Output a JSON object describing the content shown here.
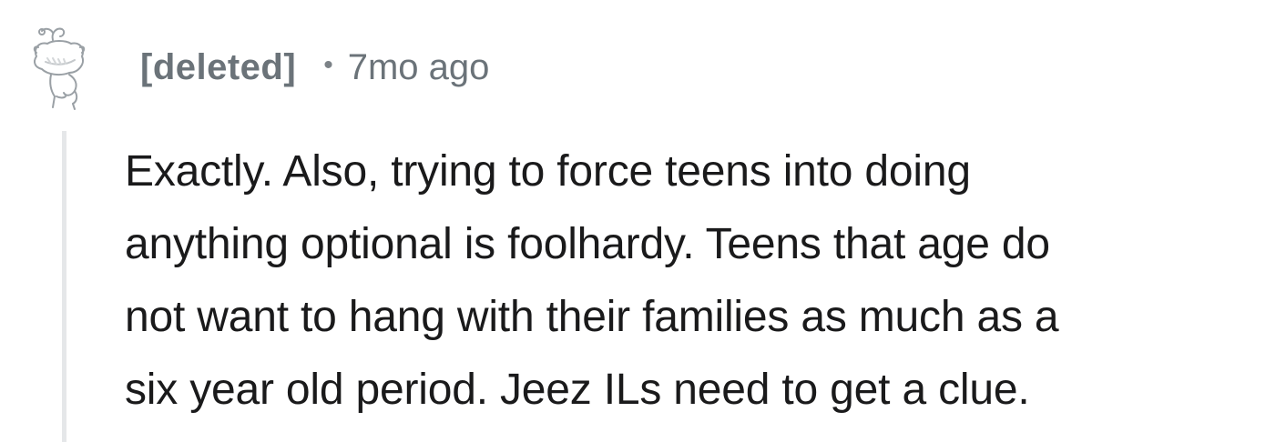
{
  "comment": {
    "author": "[deleted]",
    "separator": "•",
    "timestamp": "7mo ago",
    "avatar_icon": "snoo-sketch-icon",
    "thread_line_color": "#e5e7e9",
    "body_lines": [
      "Exactly. Also, trying to force teens into doing",
      "anything optional is foolhardy. Teens that age do",
      "not want to hang with their families as much as a",
      "six year old period. Jeez ILs need to get a clue."
    ]
  }
}
